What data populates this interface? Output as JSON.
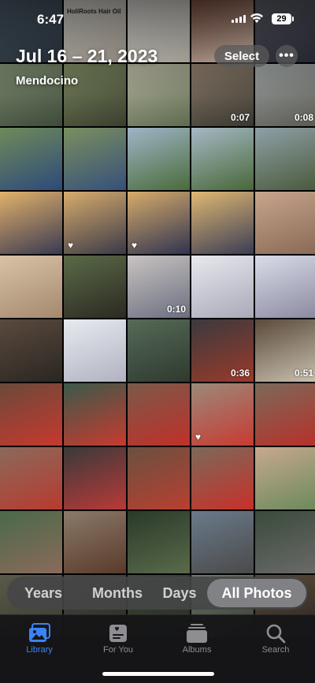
{
  "status_bar": {
    "time": "6:47",
    "battery": "29"
  },
  "header": {
    "date_range": "Jul 16 – 21, 2023",
    "location": "Mendocino",
    "select_label": "Select",
    "more_label": "•••"
  },
  "photos": [
    {
      "colors": [
        "#556676",
        "#2e3a44"
      ],
      "badge": ""
    },
    {
      "colors": [
        "#efeee8",
        "#b2a89b"
      ],
      "badge": "",
      "caption": "HoliRoots Hair Oil"
    },
    {
      "colors": [
        "#f2f1ec",
        "#c7c2b7"
      ],
      "badge": ""
    },
    {
      "colors": [
        "#8a5a49",
        "#d8c4b6"
      ],
      "badge": ""
    },
    {
      "colors": [
        "#6a6a78",
        "#2c2f3a"
      ],
      "badge": ""
    },
    {
      "colors": [
        "#7a8a6e",
        "#3f4a3a"
      ],
      "badge": ""
    },
    {
      "colors": [
        "#79845f",
        "#3a3f2e"
      ],
      "badge": ""
    },
    {
      "colors": [
        "#b4b39f",
        "#5e6b50"
      ],
      "badge": ""
    },
    {
      "colors": [
        "#8a7a6a",
        "#39382f"
      ],
      "badge": "0:07"
    },
    {
      "colors": [
        "#9aa0a0",
        "#5b5a52"
      ],
      "badge": "0:08"
    },
    {
      "colors": [
        "#6f8a5a",
        "#2d4a7a"
      ],
      "badge": ""
    },
    {
      "colors": [
        "#7b8f5f",
        "#36507a"
      ],
      "badge": ""
    },
    {
      "colors": [
        "#9fb4c8",
        "#4b6b3a"
      ],
      "badge": ""
    },
    {
      "colors": [
        "#a6b8c6",
        "#486838"
      ],
      "badge": ""
    },
    {
      "colors": [
        "#8fa0a8",
        "#4a5a3a"
      ],
      "badge": ""
    },
    {
      "colors": [
        "#e2b16a",
        "#3a3a52"
      ],
      "badge": ""
    },
    {
      "colors": [
        "#d8ac6c",
        "#3a3a48"
      ],
      "badge": "heart"
    },
    {
      "colors": [
        "#d7ab6a",
        "#303450"
      ],
      "badge": "heart"
    },
    {
      "colors": [
        "#e0b872",
        "#3b3d55"
      ],
      "badge": ""
    },
    {
      "colors": [
        "#c7a58d",
        "#8a6a55"
      ],
      "badge": ""
    },
    {
      "colors": [
        "#d8c2a4",
        "#a48a70"
      ],
      "badge": ""
    },
    {
      "colors": [
        "#5a6a48",
        "#2c2a22"
      ],
      "badge": ""
    },
    {
      "colors": [
        "#c9c4c2",
        "#6b6f80"
      ],
      "badge": "0:10"
    },
    {
      "colors": [
        "#e8e8ee",
        "#a9a9b9"
      ],
      "badge": ""
    },
    {
      "colors": [
        "#d9dce8",
        "#8a8aa0"
      ],
      "badge": ""
    },
    {
      "colors": [
        "#5a4a3e",
        "#2a2622"
      ],
      "badge": ""
    },
    {
      "colors": [
        "#e8eaf0",
        "#b0b2c0"
      ],
      "badge": ""
    },
    {
      "colors": [
        "#566a58",
        "#2e3a2e"
      ],
      "badge": ""
    },
    {
      "colors": [
        "#3a3a3e",
        "#9a3a2a"
      ],
      "badge": "0:36"
    },
    {
      "colors": [
        "#5a4a3a",
        "#c9c0b0"
      ],
      "badge": "0:51"
    },
    {
      "colors": [
        "#6a4a3a",
        "#c8382e"
      ],
      "badge": ""
    },
    {
      "colors": [
        "#3a5a4a",
        "#c83a30"
      ],
      "badge": ""
    },
    {
      "colors": [
        "#7a5a48",
        "#c0302a"
      ],
      "badge": ""
    },
    {
      "colors": [
        "#9a8a7a",
        "#c83a32"
      ],
      "badge": "heart"
    },
    {
      "colors": [
        "#7a6a5a",
        "#b8302a"
      ],
      "badge": ""
    },
    {
      "colors": [
        "#8a6a5a",
        "#b83a30"
      ],
      "badge": ""
    },
    {
      "colors": [
        "#3a3a3a",
        "#b83a38"
      ],
      "badge": ""
    },
    {
      "colors": [
        "#6a5040",
        "#b84030"
      ],
      "badge": ""
    },
    {
      "colors": [
        "#7a6a5a",
        "#c8302a"
      ],
      "badge": ""
    },
    {
      "colors": [
        "#c8a890",
        "#6a8a5a"
      ],
      "badge": ""
    },
    {
      "colors": [
        "#4a6a4a",
        "#8a6a5a"
      ],
      "badge": ""
    },
    {
      "colors": [
        "#8a7a6a",
        "#5a3a2a"
      ],
      "badge": ""
    },
    {
      "colors": [
        "#2a3a2a",
        "#5a6a4a"
      ],
      "badge": ""
    },
    {
      "colors": [
        "#6a7a8a",
        "#4a4a4a"
      ],
      "badge": ""
    },
    {
      "colors": [
        "#3a4a3a",
        "#6a6a6a"
      ],
      "badge": ""
    },
    {
      "colors": [
        "#5a5a4a",
        "#3a3a30"
      ],
      "badge": ""
    },
    {
      "colors": [
        "#4a4a3e",
        "#2a2a26"
      ],
      "badge": ""
    },
    {
      "colors": [
        "#3a4a34",
        "#2a2a24"
      ],
      "badge": ""
    },
    {
      "colors": [
        "#6a7a6a",
        "#3a3a30"
      ],
      "badge": ""
    },
    {
      "colors": [
        "#5a4a3a",
        "#2a2420"
      ],
      "badge": ""
    }
  ],
  "segmented": {
    "items": [
      "Years",
      "Months",
      "Days",
      "All Photos"
    ],
    "active_index": 3
  },
  "tabbar": {
    "items": [
      {
        "label": "Library",
        "icon": "library-icon"
      },
      {
        "label": "For You",
        "icon": "for-you-icon"
      },
      {
        "label": "Albums",
        "icon": "albums-icon"
      },
      {
        "label": "Search",
        "icon": "search-icon"
      }
    ],
    "active_index": 0
  }
}
